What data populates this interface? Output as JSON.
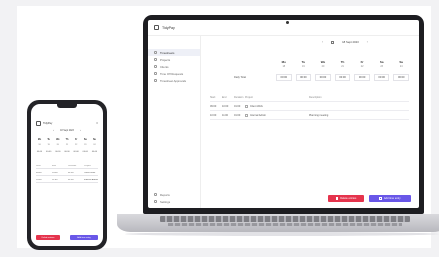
{
  "app": {
    "title": "TidyPay"
  },
  "sidebar": {
    "items": [
      {
        "label": "Timesheets",
        "icon": "clock-icon",
        "active": true
      },
      {
        "label": "Projects",
        "icon": "folder-icon",
        "active": false
      },
      {
        "label": "Clients",
        "icon": "users-icon",
        "active": false
      },
      {
        "label": "Time Off Requests",
        "icon": "calendar-icon",
        "active": false
      },
      {
        "label": "Timesheet Approvals",
        "icon": "check-icon",
        "active": false
      }
    ],
    "bottom_items": [
      {
        "label": "Reports",
        "icon": "chart-icon"
      },
      {
        "label": "Settings",
        "icon": "gear-icon"
      }
    ]
  },
  "week": {
    "label": "18 Sept 2023",
    "prev": "‹",
    "next": "›"
  },
  "days": [
    {
      "day": "Mo",
      "date": "18"
    },
    {
      "day": "Tu",
      "date": "19"
    },
    {
      "day": "We",
      "date": "20"
    },
    {
      "day": "Th",
      "date": "21"
    },
    {
      "day": "Fr",
      "date": "22"
    },
    {
      "day": "Sa",
      "date": "23"
    },
    {
      "day": "Su",
      "date": "24"
    }
  ],
  "totals": {
    "label": "Daily Total",
    "values": [
      "00:00",
      "00:00",
      "00:00",
      "00:00",
      "00:00",
      "00:00",
      "00:00"
    ]
  },
  "table": {
    "headers": [
      "Start",
      "End",
      "Duration",
      "Project",
      "Description"
    ],
    "rows": [
      {
        "start": "09:00",
        "end": "10:00",
        "duration": "01:00",
        "project": "Client Work",
        "description": ""
      },
      {
        "start": "10:00",
        "end": "11:00",
        "duration": "01:00",
        "project": "Internal Admin",
        "description": "Planning meeting"
      }
    ]
  },
  "actions": {
    "delete": "Delete entries",
    "add": "Add time entry"
  },
  "colors": {
    "danger": "#e5344d",
    "primary": "#6957e8"
  }
}
